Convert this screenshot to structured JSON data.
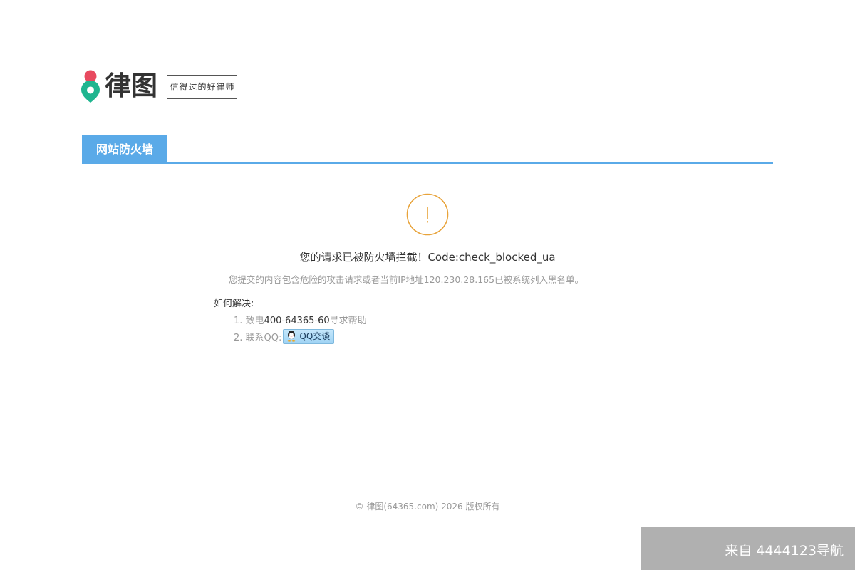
{
  "logo": {
    "brand": "律图",
    "tagline": "信得过的好律师"
  },
  "tab": {
    "label": "网站防火墙"
  },
  "message": {
    "title": "您的请求已被防火墙拦截！Code:check_blocked_ua",
    "description": "您提交的内容包含危险的攻击请求或者当前IP地址120.230.28.165已被系统列入黑名单。"
  },
  "solution": {
    "heading": "如何解决:",
    "step1_prefix": "1. 致电",
    "step1_phone": "400-64365-60",
    "step1_suffix": "寻求帮助",
    "step2_prefix": "2. 联系QQ:",
    "qq_button_label": "QQ交谈"
  },
  "footer": {
    "copyright": "© 律图(64365.com) 2026 版权所有"
  },
  "watermark": {
    "text": "来自 4444123导航"
  },
  "colors": {
    "accent": "#5aaae8",
    "warning": "#e8a33a",
    "logo_red": "#e84a5f",
    "logo_green": "#1fb58f"
  }
}
